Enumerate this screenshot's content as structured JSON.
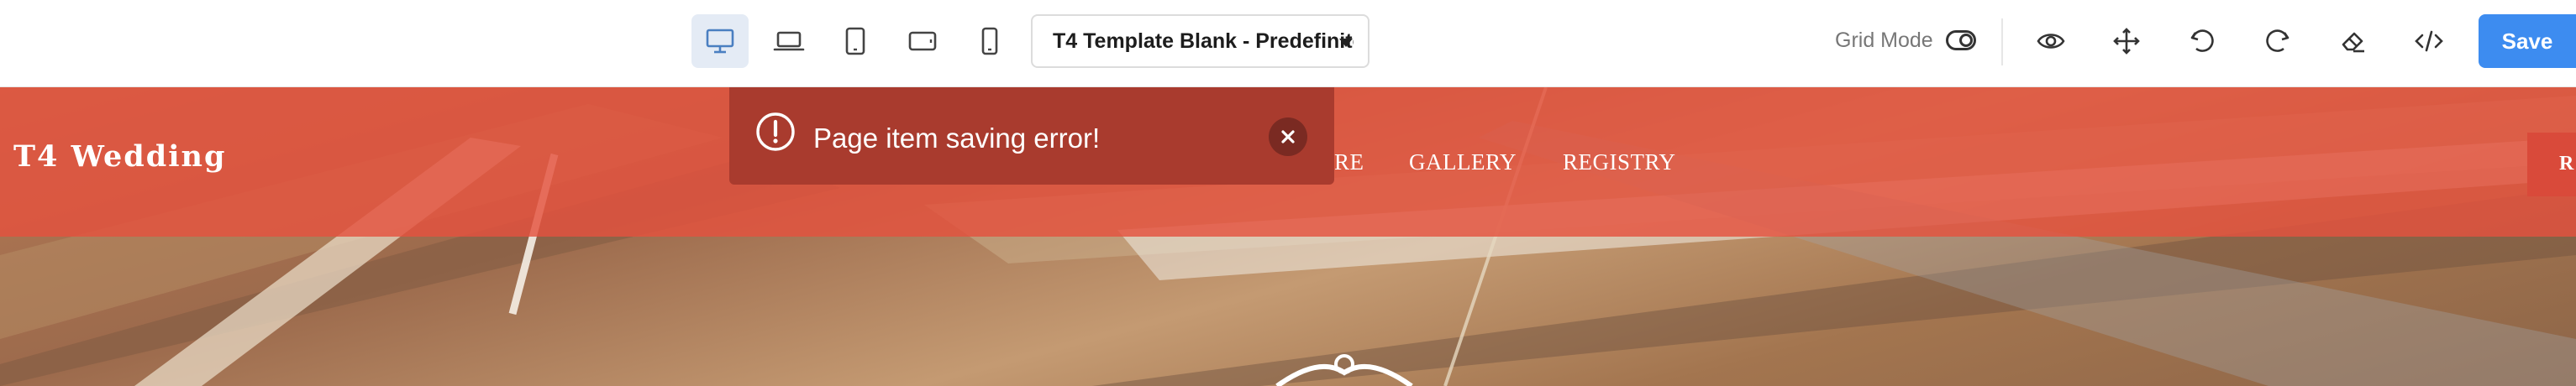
{
  "toolbar": {
    "template_select_value": "T4 Template Blank - Predefinito*",
    "grid_mode_label": "Grid Mode",
    "save_label": "Save",
    "accent_color": "#3d8cf0",
    "device_buttons": [
      "desktop-icon",
      "laptop-icon",
      "tablet-portrait-icon",
      "tablet-landscape-icon",
      "mobile-icon"
    ],
    "tools": [
      "eye-icon",
      "move-icon",
      "undo-icon",
      "redo-icon",
      "eraser-icon",
      "code-icon"
    ]
  },
  "site": {
    "brand": "T4 Wedding",
    "nav": [
      {
        "label": "RE"
      },
      {
        "label": "GALLERY"
      },
      {
        "label": "REGISTRY"
      }
    ],
    "cta_label": "R",
    "navbar_color": "#e4523e"
  },
  "toast": {
    "message": "Page item saving error!",
    "background": "#a93b2e"
  }
}
